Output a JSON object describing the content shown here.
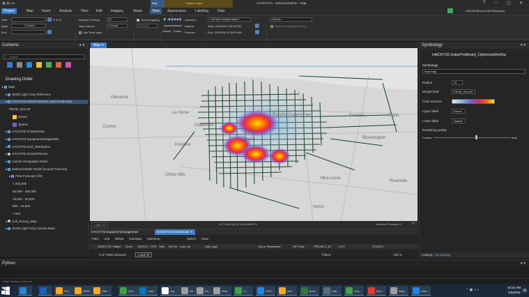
{
  "titlebar": {
    "title": "ArcGIS Pro - SolarHackathon - Map",
    "context_map": "Map",
    "context_layer": "Feature Layer",
    "user": "HACK0039 (ArcGIS Enterprise)"
  },
  "tabs": [
    "Project",
    "Map",
    "Insert",
    "Analysis",
    "View",
    "Edit",
    "Imagery",
    "Share",
    "Time",
    "Appearance",
    "Labeling",
    "Data"
  ],
  "ribbon": {
    "start_label": "Start",
    "span_label": "Span",
    "span_unit": "Hours",
    "end_label": "End",
    "steps_label": "Number of Steps",
    "steps_value": "19",
    "step_interval_label": "Step Interval",
    "step_interval_unit": "1 Hours",
    "use_time_span": "Use Time Span",
    "current_time_group": "Current Time",
    "step_group": "Step",
    "time_snapping": "Time Snapping",
    "seconds": "Seconds",
    "snapping_group": "Snapping",
    "direction_label": "Direction",
    "repeat_label": "Repeat",
    "reverse_label": "Reverse",
    "slower": "Slower",
    "faster": "Faster",
    "playback_group": "Playback",
    "full_extent_value": "< All time-enabled data >",
    "full_start": "Start: 2/5/2018 5:00:00 PM",
    "full_end": "End: 2/5/2018 12:00:00 AM",
    "full_extent_group": "Full Extent",
    "none_value": "<None>",
    "adjust_daylight": "Adjust for Daylight Saving",
    "time_zone_group": "Time Zone"
  },
  "contents": {
    "title": "Contents",
    "search_placeholder": "Search",
    "drawing_order": "Drawing Order",
    "items": [
      {
        "label": "Map",
        "indent": 0,
        "checked": true
      },
      {
        "label": "World Light Gray Reference",
        "indent": 1,
        "checked": true
      },
      {
        "label": "HACKT02.SolarPreModel_OptimizedHotSp",
        "indent": 1,
        "checked": true,
        "selected": true
      },
      {
        "label": "PROB_SOLAR",
        "indent": 2,
        "checked": null
      },
      {
        "label": "Dense",
        "indent": 3,
        "checked": null,
        "swatch": "#f5c242"
      },
      {
        "label": "Sparse",
        "indent": 3,
        "checked": null,
        "swatch": "#7a5ad0"
      },
      {
        "label": "HACKT02.OntarioSolar",
        "indent": 1,
        "checked": true
      },
      {
        "label": "HACKT02.EquipmentOutageMain",
        "indent": 1,
        "checked": true
      },
      {
        "label": "HACKT02.Grid_Distribution",
        "indent": 1,
        "checked": true
      },
      {
        "label": "HACKT02.OntarioParcels",
        "indent": 1,
        "checked": false
      },
      {
        "label": "Human Geography Detail",
        "indent": 1,
        "checked": true
      },
      {
        "label": "National Water Model (Hourly Forecast)",
        "indent": 1,
        "checked": true
      },
      {
        "label": "Flow Forecast (cfs)",
        "indent": 2,
        "checked": true
      },
      {
        "label": "> 250,000",
        "indent": 3,
        "checked": null
      },
      {
        "label": "50,000 - 250,000",
        "indent": 3,
        "checked": null
      },
      {
        "label": "15,000 - 50,000",
        "indent": 3,
        "checked": null
      },
      {
        "label": "500 - 15,000",
        "indent": 3,
        "checked": null
      },
      {
        "label": "< 500",
        "indent": 3,
        "checked": null
      },
      {
        "label": "Soil_Survey_Map",
        "indent": 1,
        "checked": false
      },
      {
        "label": "World Light Gray Canvas Base",
        "indent": 1,
        "checked": true
      }
    ]
  },
  "map": {
    "tab": "Map",
    "cities": [
      {
        "name": "Glendora"
      },
      {
        "name": "La Verne"
      },
      {
        "name": "Claremont"
      },
      {
        "name": "Rancho Cucamonga"
      },
      {
        "name": "Fontana"
      },
      {
        "name": "Rialto"
      },
      {
        "name": "Covina"
      },
      {
        "name": "Upland"
      },
      {
        "name": "Ontario"
      },
      {
        "name": "Bloomington"
      },
      {
        "name": "Pomona"
      },
      {
        "name": "Chino Hills"
      },
      {
        "name": "Mira Loma"
      },
      {
        "name": "Riverside"
      },
      {
        "name": "Norco"
      }
    ],
    "scale": "1:288,723",
    "coords": "117.4435706°W 34.0539991°N",
    "selected_features": "Selected Features: 0"
  },
  "table": {
    "tabs": [
      "HACKT02.EquipmentOutageMain",
      "HACKT02.OntarioSolar"
    ],
    "toolbar": [
      "Field:",
      "Add",
      "Delete",
      "Calculate",
      "Selection:",
      "Switch",
      "Clear"
    ],
    "columns": [
      "OBJECTID",
      "Status",
      "Score",
      "MATCH_TYPE",
      "Side",
      "Ref_ID",
      "User_fld",
      "Addr_type",
      "City or Placename",
      "ZIP Code",
      "PROJECT_ID",
      "CITY",
      "COUNTY"
    ],
    "footer": "0 of *2000 selected",
    "load_all": "Load All",
    "filters_label": "Filters:",
    "zoom": "100 %"
  },
  "symbology": {
    "title": "Symbology",
    "layer_name": "HACKT02.SolarPreModel_OptimizedHotSp",
    "primary_label": "Symbology",
    "method": "Heat Map",
    "radius_label": "Radius",
    "radius_value": "25",
    "weight_label": "Weight field",
    "weight_value": "PROB_SOLAR",
    "color_label": "Color scheme",
    "upper_label": "Upper label",
    "upper_value": "Dense",
    "lower_label": "Lower label",
    "lower_value": "Sparse",
    "quality_label": "Rendering quality",
    "quality_low": "Fastest",
    "quality_high": "Best",
    "quality_fraction": 0.55,
    "bottom_tabs": [
      "Catalog",
      "Symbology"
    ]
  },
  "python": {
    "title": "Python",
    "placeholder": "Enter Python code here"
  },
  "taskbar": {
    "apps": [
      {
        "label": "",
        "color": "#2a82da"
      },
      {
        "label": "",
        "color": "#1565c0"
      },
      {
        "label": "Ont...",
        "color": "#f9a825"
      },
      {
        "label": "ESRI...",
        "color": "#f9a825"
      },
      {
        "label": "SAP...",
        "color": "#f9a825"
      },
      {
        "label": "Onli...",
        "color": "#43a047"
      },
      {
        "label": "Cale...",
        "color": "#0277bd"
      },
      {
        "label": "Arg...",
        "color": "#ffffff"
      },
      {
        "label": "Ad...",
        "color": "#9e9e9e"
      },
      {
        "label": "Ad...",
        "color": "#9e9e9e"
      },
      {
        "label": "Sele...",
        "color": "#9e9e9e"
      },
      {
        "label": "Cl...",
        "color": "#43a047"
      },
      {
        "label": "FS D...",
        "color": "#1e88e5"
      },
      {
        "label": "Indi...",
        "color": "#f9a825"
      },
      {
        "label": "Bool...",
        "color": "#2e7d32"
      },
      {
        "label": "Dail...",
        "color": "#546e7a"
      },
      {
        "label": "Goo...",
        "color": "#43a047"
      },
      {
        "label": "Elec...",
        "color": "#e53935"
      },
      {
        "label": "Sear...",
        "color": "#9e9e9e"
      },
      {
        "label": "Sele...",
        "color": "#1e88e5"
      }
    ],
    "time": "10:31 AM",
    "date": "2/5/2018"
  }
}
